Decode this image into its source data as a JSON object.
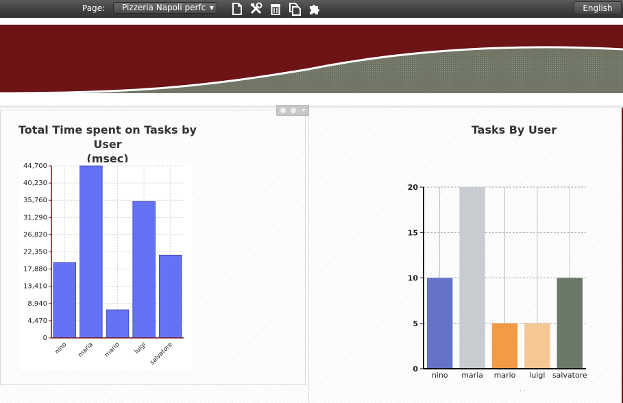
{
  "toolbar": {
    "page_label": "Page:",
    "page_select_value": "Pizzeria Napoli perfc",
    "icons": [
      "new-page-icon",
      "tools-icon",
      "trash-icon",
      "copy-page-icon",
      "puzzle-icon"
    ],
    "language": "English"
  },
  "banner": {
    "colors": {
      "maroon": "#6d1417",
      "gray": "#6f7465"
    }
  },
  "chart_data": [
    {
      "type": "bar",
      "title": "Total Time spent on Tasks by User (msec)",
      "title_lines": [
        "Total Time spent on Tasks by User",
        "(msec)"
      ],
      "categories": [
        "nino",
        "maria",
        "mario",
        "luigi",
        "salvatore"
      ],
      "values": [
        19600,
        44700,
        7300,
        35500,
        21500
      ],
      "yticks": [
        "0",
        "4,470",
        "8,940",
        "13,410",
        "17,880",
        "22,350",
        "26,820",
        "31,290",
        "35,760",
        "40,230",
        "44,700"
      ],
      "ylim": [
        0,
        44700
      ],
      "bar_color": "#6473f5",
      "grid": true
    },
    {
      "type": "bar",
      "title": "Tasks By User",
      "categories": [
        "nino",
        "maria",
        "mario",
        "luigi",
        "salvatore"
      ],
      "values": [
        10,
        20,
        5,
        5,
        10
      ],
      "yticks": [
        "0",
        "5",
        "10",
        "15",
        "20"
      ],
      "ylim": [
        0,
        20
      ],
      "colors": [
        "#6572c8",
        "#c8cbd0",
        "#f39a46",
        "#f4c794",
        "#6b7968"
      ],
      "grid": true
    }
  ]
}
